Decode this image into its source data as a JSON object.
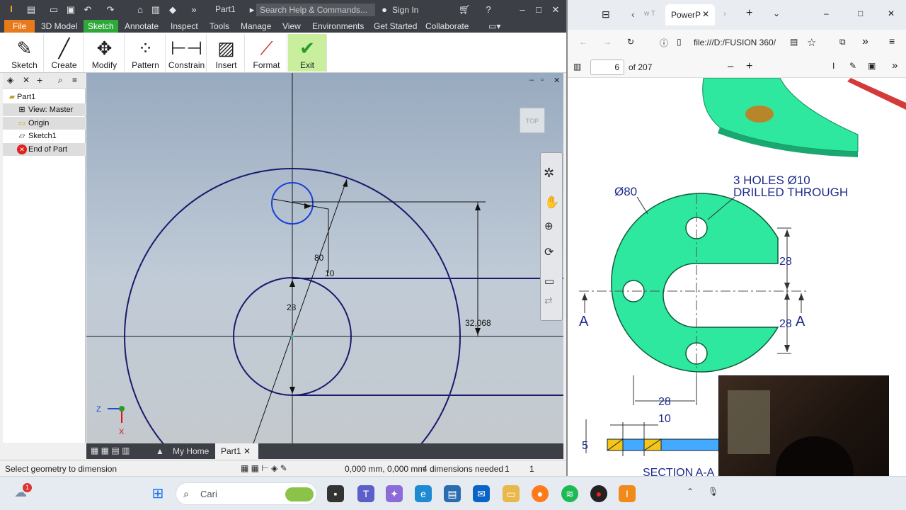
{
  "inventor": {
    "qat_title": "Part1",
    "search_placeholder": "Search Help & Commands...",
    "sign_in": "Sign In",
    "menu_tabs": [
      "File",
      "3D Model",
      "Sketch",
      "Annotate",
      "Inspect",
      "Tools",
      "Manage",
      "View",
      "Environments",
      "Get Started",
      "Collaborate"
    ],
    "ribbon": [
      "Sketch",
      "Create",
      "Modify",
      "Pattern",
      "Constrain",
      "Insert",
      "Format",
      "Exit"
    ],
    "browser_tree": [
      "Part1",
      "View: Master",
      "Origin",
      "Sketch1",
      "End of Part"
    ],
    "viewcube_label": "TOP",
    "dimensions": {
      "d80": "80",
      "d10": "10",
      "d28": "28",
      "d32": "32,068"
    },
    "triad": {
      "z": "Z",
      "x": "X"
    },
    "doc_tabs": [
      "My Home",
      "Part1"
    ],
    "status": {
      "hint": "Select geometry to dimension",
      "coords": "0,000 mm, 0,000 mm",
      "dims_needed": "4 dimensions needed",
      "val1": "1",
      "val2": "1"
    }
  },
  "pdf": {
    "tab_title": "PowerP",
    "tab_prev": "w T",
    "address": "file:///D:/FUSION 360/",
    "page_current": "6",
    "page_total": "of 207",
    "drawing": {
      "dia_label": "Ø80",
      "holes_line1": "3 HOLES Ø10",
      "holes_line2": "DRILLED THROUGH",
      "dim28_top": "28",
      "dim28_bottom": "28",
      "dim28_horiz": "28",
      "dim10": "10",
      "dim5": "5",
      "sectionA_left": "A",
      "sectionA_right": "A",
      "section_title": "SECTION A-A"
    }
  },
  "taskbar": {
    "search": "Cari",
    "badge": "1"
  },
  "colors": {
    "sketch_line": "#1a1a6e",
    "part_green": "#2ee8a0",
    "dim_blue": "#1e2a8c",
    "exit_green": "#c9ef9e"
  }
}
